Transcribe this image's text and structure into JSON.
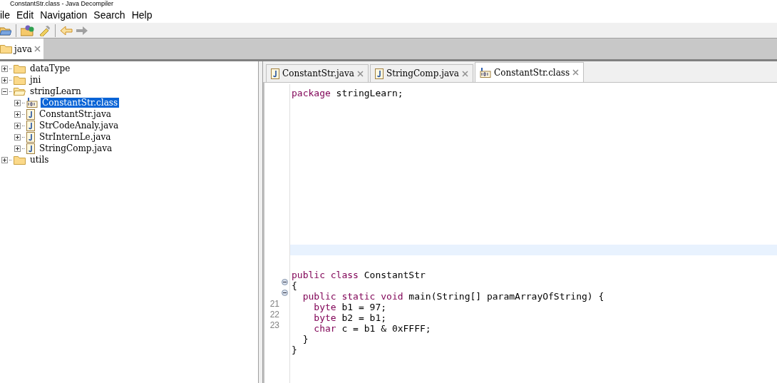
{
  "window": {
    "title": "ConstantStr.class - Java Decompiler"
  },
  "menu": [
    "ile",
    "Edit",
    "Navigation",
    "Search",
    "Help"
  ],
  "toolbar": [
    {
      "kind": "open"
    },
    {
      "kind": "open-type"
    },
    {
      "kind": "search"
    },
    {
      "kind": "back",
      "disabled": false
    },
    {
      "kind": "forward",
      "disabled": true
    }
  ],
  "file_tabs": [
    {
      "label": "java",
      "selected": true
    }
  ],
  "tree": [
    {
      "label": "dataType",
      "kind": "folder",
      "expanded": false,
      "selected": false
    },
    {
      "label": "jni",
      "kind": "folder",
      "expanded": false,
      "selected": false
    },
    {
      "label": "stringLearn",
      "kind": "folder",
      "expanded": true,
      "selected": false,
      "children": [
        {
          "label": "ConstantStr.class",
          "kind": "class",
          "expanded": false,
          "selected": true
        },
        {
          "label": "ConstantStr.java",
          "kind": "java",
          "expanded": false,
          "selected": false
        },
        {
          "label": "StrCodeAnaly.java",
          "kind": "java",
          "expanded": false,
          "selected": false
        },
        {
          "label": "StrInternLe.java",
          "kind": "java",
          "expanded": false,
          "selected": false
        },
        {
          "label": "StringComp.java",
          "kind": "java",
          "expanded": false,
          "selected": false
        }
      ]
    },
    {
      "label": "utils",
      "kind": "folder",
      "expanded": false,
      "selected": false
    }
  ],
  "editor_tabs": [
    {
      "label": "ConstantStr.java",
      "kind": "java",
      "selected": false
    },
    {
      "label": "StringComp.java",
      "kind": "java",
      "selected": false
    },
    {
      "label": "ConstantStr.class",
      "kind": "class",
      "selected": true
    }
  ],
  "code": [
    {
      "kind": "code",
      "tokens": [
        {
          "text": "package",
          "kind": "keyword"
        },
        {
          "text": " stringLearn;",
          "kind": "plain"
        }
      ]
    },
    {
      "kind": "blank"
    },
    {
      "kind": "blank"
    },
    {
      "kind": "blank"
    },
    {
      "kind": "blank"
    },
    {
      "kind": "blank"
    },
    {
      "kind": "blank"
    },
    {
      "kind": "blank"
    },
    {
      "kind": "blank"
    },
    {
      "kind": "blank"
    },
    {
      "kind": "blank"
    },
    {
      "kind": "blank"
    },
    {
      "kind": "blank"
    },
    {
      "kind": "blank"
    },
    {
      "kind": "blank"
    },
    {
      "kind": "blank",
      "highlighted": true
    },
    {
      "kind": "blank"
    },
    {
      "kind": "code",
      "tokens": [
        {
          "text": "public class",
          "kind": "keyword"
        },
        {
          "text": " ConstantStr",
          "kind": "plain"
        }
      ]
    },
    {
      "kind": "code",
      "fold": true,
      "tokens": [
        {
          "text": "{",
          "kind": "plain"
        }
      ]
    },
    {
      "kind": "code",
      "fold": true,
      "tokens": [
        {
          "text": "  public static void",
          "kind": "keyword"
        },
        {
          "text": " main(String[] paramArrayOfString) {",
          "kind": "plain"
        }
      ]
    },
    {
      "kind": "code",
      "number": "21",
      "tokens": [
        {
          "text": "    byte",
          "kind": "keyword"
        },
        {
          "text": " b1 = 97;",
          "kind": "plain"
        }
      ]
    },
    {
      "kind": "code",
      "number": "22",
      "tokens": [
        {
          "text": "    byte",
          "kind": "keyword"
        },
        {
          "text": " b2 = b1;",
          "kind": "plain"
        }
      ]
    },
    {
      "kind": "code",
      "number": "23",
      "tokens": [
        {
          "text": "    char",
          "kind": "keyword"
        },
        {
          "text": " c = b1 & 0xFFFF;",
          "kind": "plain"
        }
      ]
    },
    {
      "kind": "code",
      "tokens": [
        {
          "text": "  }",
          "kind": "plain"
        }
      ]
    },
    {
      "kind": "code",
      "tokens": [
        {
          "text": "}",
          "kind": "plain"
        }
      ]
    }
  ]
}
